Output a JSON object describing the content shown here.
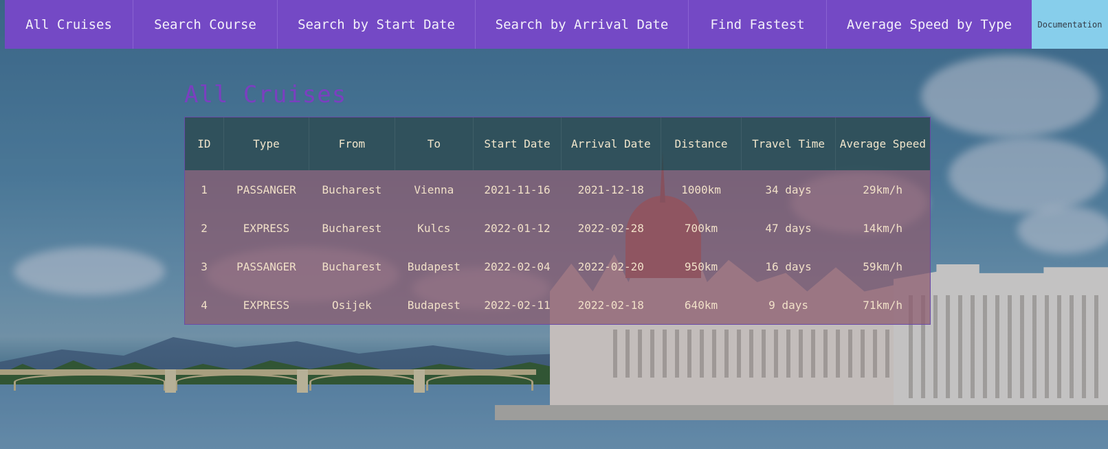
{
  "nav": {
    "items": [
      {
        "label": "All Cruises"
      },
      {
        "label": "Search Course"
      },
      {
        "label": "Search by Start Date"
      },
      {
        "label": "Search by Arrival Date"
      },
      {
        "label": "Find Fastest"
      },
      {
        "label": "Average Speed by Type"
      }
    ],
    "documentation": "Documentation"
  },
  "page": {
    "title": "All Cruises"
  },
  "table": {
    "headers": [
      "ID",
      "Type",
      "From",
      "To",
      "Start Date",
      "Arrival Date",
      "Distance",
      "Travel Time",
      "Average Speed"
    ],
    "rows": [
      [
        "1",
        "PASSANGER",
        "Bucharest",
        "Vienna",
        "2021-11-16",
        "2021-12-18",
        "1000km",
        "34 days",
        "29km/h"
      ],
      [
        "2",
        "EXPRESS",
        "Bucharest",
        "Kulcs",
        "2022-01-12",
        "2022-02-28",
        "700km",
        "47 days",
        "14km/h"
      ],
      [
        "3",
        "PASSANGER",
        "Bucharest",
        "Budapest",
        "2022-02-04",
        "2022-02-20",
        "950km",
        "16 days",
        "59km/h"
      ],
      [
        "4",
        "EXPRESS",
        "Osijek",
        "Budapest",
        "2022-02-11",
        "2022-02-18",
        "640km",
        "9 days",
        "71km/h"
      ]
    ]
  },
  "colors": {
    "nav_bg": "#7449c5",
    "doc_bg": "#87ceeb",
    "title": "#7b3fc0",
    "table_header_bg": "#2e4c54",
    "table_row_bg": "#8c5a6e"
  }
}
